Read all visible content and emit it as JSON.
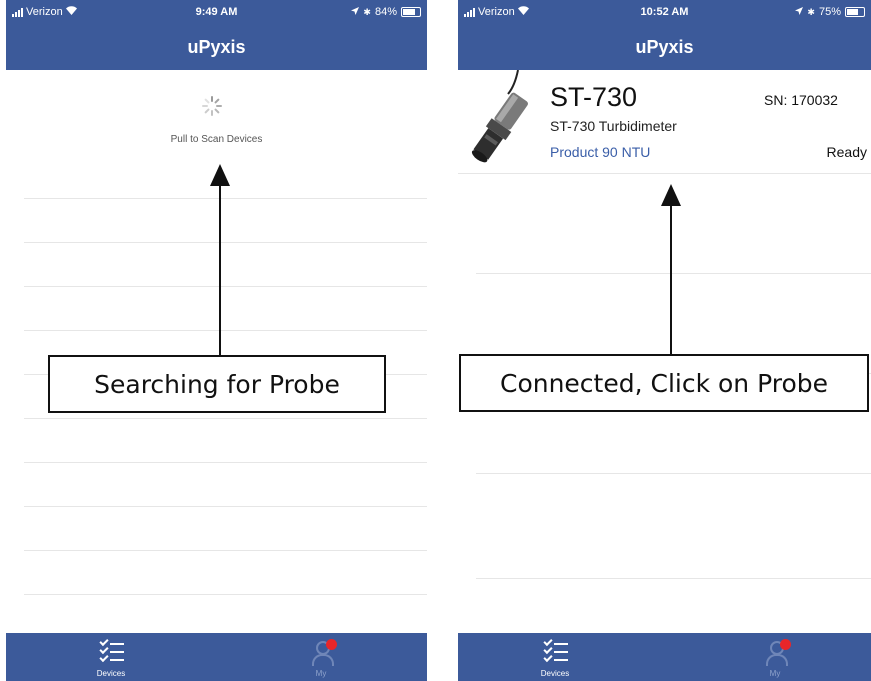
{
  "left_screen": {
    "status": {
      "carrier": "Verizon",
      "time": "9:49 AM",
      "battery": "84%",
      "battery_level": 0.84
    },
    "title": "uPyxis",
    "pull_text": "Pull to Scan Devices",
    "tabs": [
      {
        "label": "Devices",
        "icon": "checklist-icon"
      },
      {
        "label": "My",
        "icon": "person-icon"
      }
    ],
    "callout": "Searching for Probe"
  },
  "right_screen": {
    "status": {
      "carrier": "Verizon",
      "time": "10:52 AM",
      "battery": "75%",
      "battery_level": 0.75
    },
    "title": "uPyxis",
    "device": {
      "name": "ST-730",
      "model": "ST-730 Turbidimeter",
      "product": "Product 90 NTU",
      "serial": "SN: 170032",
      "status": "Ready"
    },
    "tabs": [
      {
        "label": "Devices",
        "icon": "checklist-icon"
      },
      {
        "label": "My",
        "icon": "person-icon"
      }
    ],
    "callout": "Connected, Click on Probe"
  },
  "colors": {
    "header_blue": "#3c5a9a",
    "badge_red": "#e8262a",
    "product_link": "#3a5ea8"
  }
}
